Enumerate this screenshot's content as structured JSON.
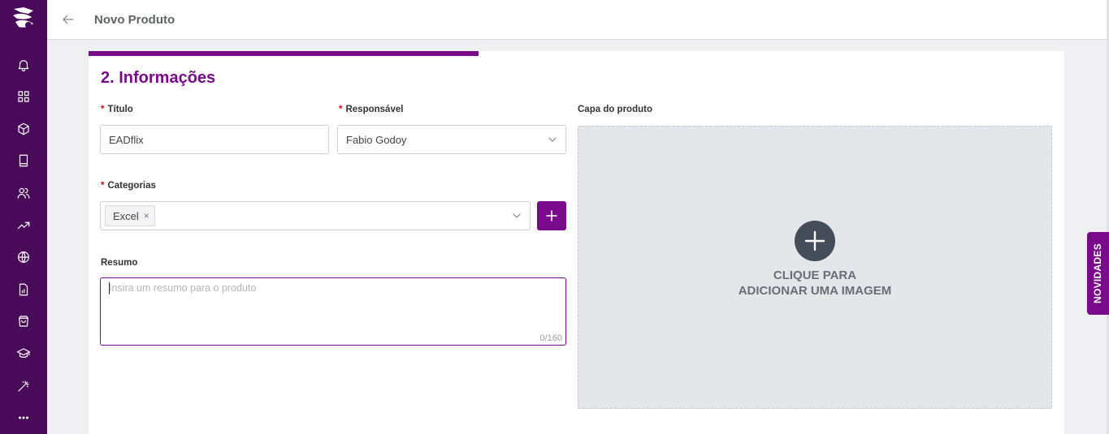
{
  "header": {
    "title": "Novo Produto"
  },
  "sidebar": {
    "items": [
      {
        "icon": "bell-icon"
      },
      {
        "icon": "grid-icon"
      },
      {
        "icon": "box-icon"
      },
      {
        "icon": "book-icon"
      },
      {
        "icon": "users-icon"
      },
      {
        "icon": "trending-up-icon"
      },
      {
        "icon": "globe-icon"
      },
      {
        "icon": "report-icon"
      },
      {
        "icon": "shopping-bag-icon"
      },
      {
        "icon": "graduation-cap-icon"
      },
      {
        "icon": "magic-wand-icon"
      },
      {
        "icon": "more-icon"
      }
    ]
  },
  "form": {
    "progress": 0.4,
    "section_title": "2. Informações",
    "titulo": {
      "required_mark": "*",
      "label": "Título",
      "value": "EADflix"
    },
    "responsavel": {
      "required_mark": "*",
      "label": "Responsável",
      "value": "Fabio Godoy"
    },
    "categorias": {
      "required_mark": "*",
      "label": "Categorias",
      "tags": [
        "Excel"
      ],
      "remove_symbol": "×"
    },
    "resumo": {
      "label": "Resumo",
      "placeholder": "Insira um resumo para o produto",
      "counter": "0/160"
    },
    "capa": {
      "label": "Capa do produto",
      "line1": "CLIQUE PARA",
      "line2": "ADICIONAR UMA IMAGEM"
    }
  },
  "novidades": {
    "label": "NOVIDADES"
  },
  "colors": {
    "primary": "#7a0a8c",
    "sidebar": "#4a0a5a",
    "required": "#e0001b"
  }
}
